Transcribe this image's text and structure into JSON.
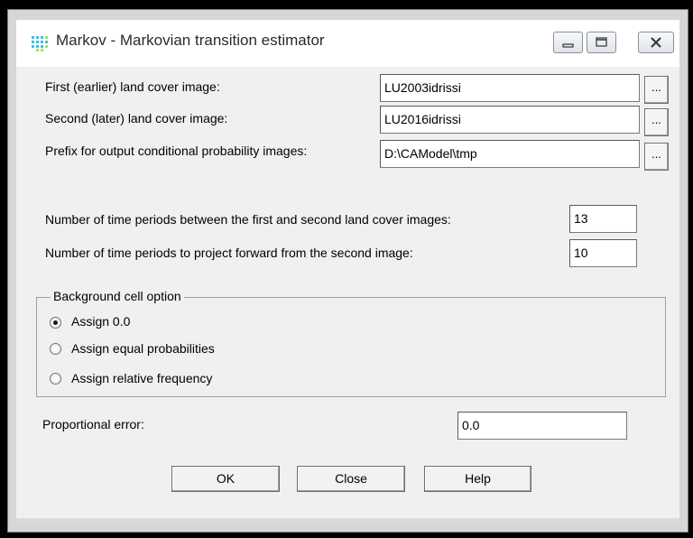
{
  "window": {
    "title": "Markov - Markovian transition estimator",
    "icon": "grid-app-icon",
    "controls": [
      "minimize-icon",
      "maximize-icon",
      "close-icon"
    ]
  },
  "inputs": {
    "first_image": {
      "label": "First (earlier) land cover image:",
      "value": "LU2003idrissi",
      "browse_label": "..."
    },
    "second_image": {
      "label": "Second (later) land cover image:",
      "value": "LU2016idrissi",
      "browse_label": "..."
    },
    "prefix": {
      "label": "Prefix for output conditional probability images:",
      "value": "D:\\CAModel\\tmp",
      "browse_label": "..."
    }
  },
  "periods": {
    "between_label": "Number of time periods between the first and second land cover images:",
    "between_value": "13",
    "forward_label": "Number of time periods to project forward from the second image:",
    "forward_value": "10"
  },
  "background": {
    "legend": "Background cell option",
    "options": [
      {
        "label": "Assign 0.0",
        "selected": true
      },
      {
        "label": "Assign equal probabilities",
        "selected": false
      },
      {
        "label": "Assign relative frequency",
        "selected": false
      }
    ]
  },
  "error": {
    "label": "Proportional error:",
    "value": "0.0"
  },
  "buttons": {
    "ok": "OK",
    "close": "Close",
    "help": "Help"
  }
}
